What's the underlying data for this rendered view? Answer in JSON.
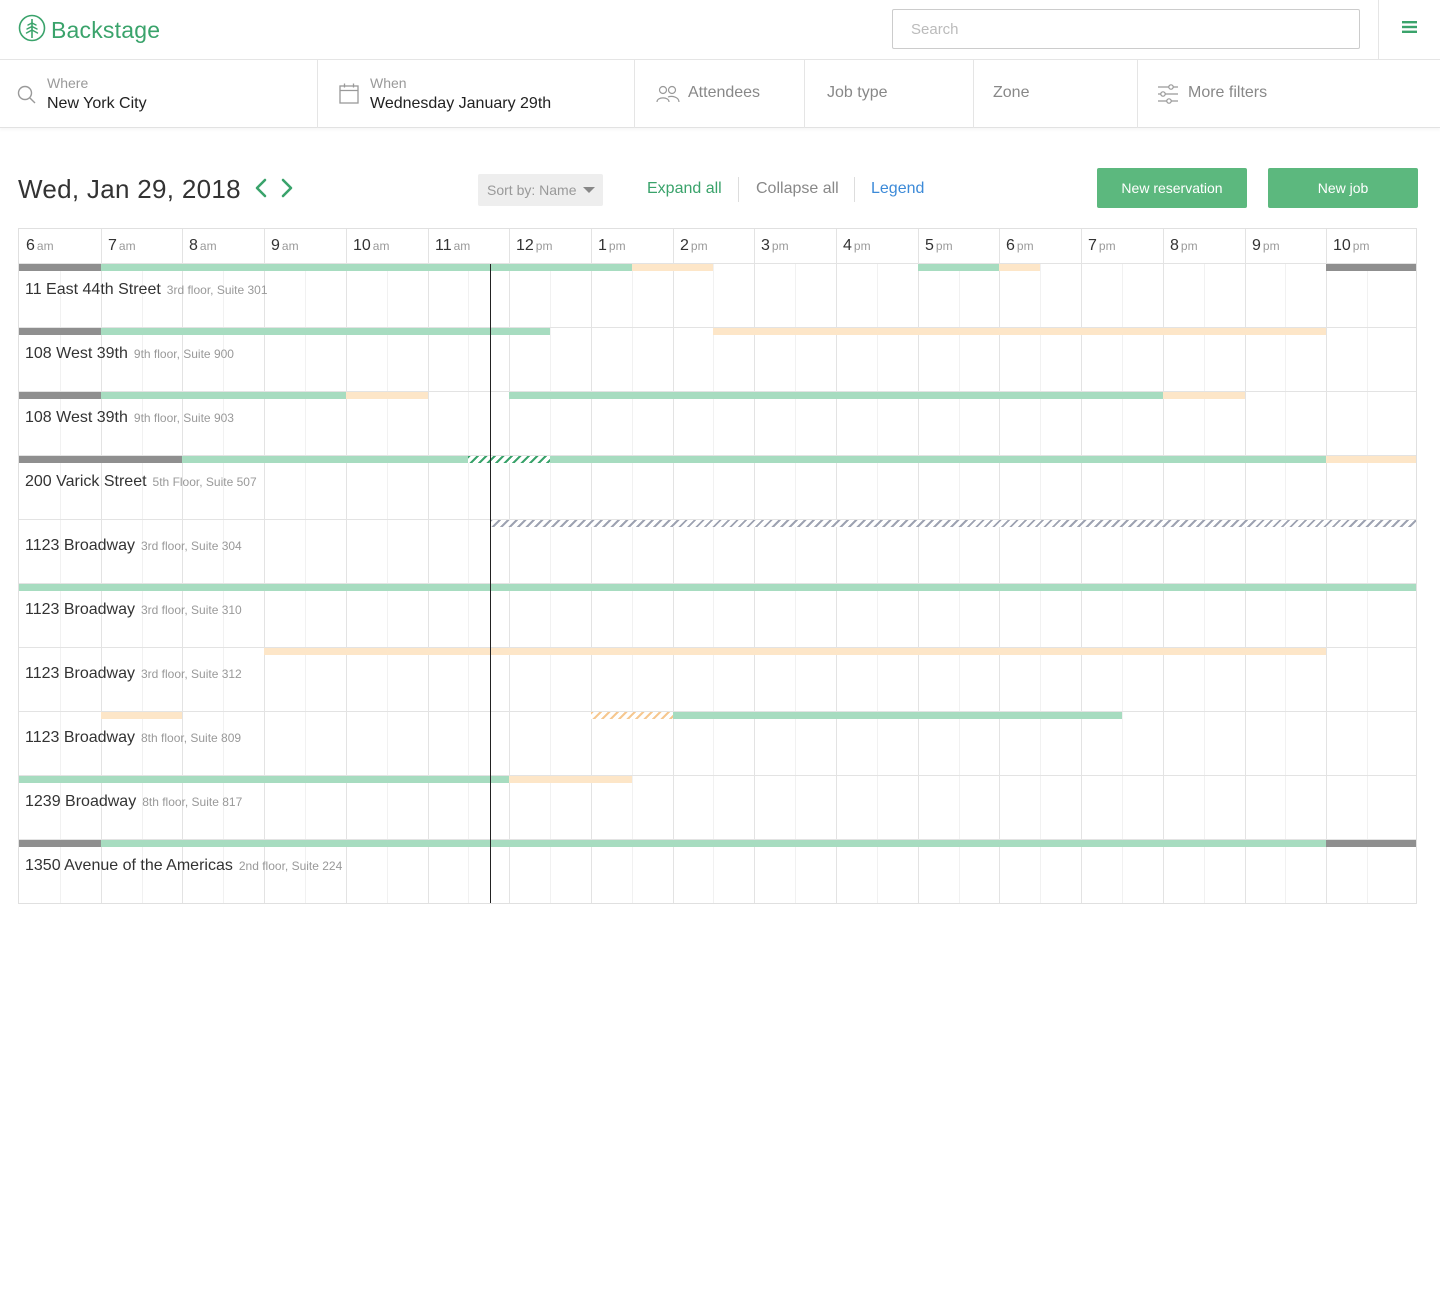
{
  "app": {
    "name": "Backstage"
  },
  "search": {
    "placeholder": "Search"
  },
  "filters": {
    "where": {
      "label": "Where",
      "value": "New York City"
    },
    "when": {
      "label": "When",
      "value": "Wednesday January 29th"
    },
    "attendees": "Attendees",
    "job_type": "Job type",
    "zone": "Zone",
    "more": "More filters"
  },
  "toolbar": {
    "date": "Wed, Jan 29, 2018",
    "sort_label": "Sort by: Name",
    "expand_all": "Expand all",
    "collapse_all": "Collapse all",
    "legend": "Legend",
    "new_reservation": "New reservation",
    "new_job": "New job"
  },
  "colors": {
    "brand": "#3aa36b",
    "button_green": "#5cb87e",
    "link_blue": "#3c8ad8",
    "reserved": "#a7dcc0",
    "pending": "#fde6c8",
    "closed": "#8f8f8f"
  },
  "schedule": {
    "hours": [
      {
        "num": "6",
        "suffix": "am"
      },
      {
        "num": "7",
        "suffix": "am"
      },
      {
        "num": "8",
        "suffix": "am"
      },
      {
        "num": "9",
        "suffix": "am"
      },
      {
        "num": "10",
        "suffix": "am"
      },
      {
        "num": "11",
        "suffix": "am"
      },
      {
        "num": "12",
        "suffix": "pm"
      },
      {
        "num": "1",
        "suffix": "pm"
      },
      {
        "num": "2",
        "suffix": "pm"
      },
      {
        "num": "3",
        "suffix": "pm"
      },
      {
        "num": "4",
        "suffix": "pm"
      },
      {
        "num": "5",
        "suffix": "pm"
      },
      {
        "num": "6",
        "suffix": "pm"
      },
      {
        "num": "7",
        "suffix": "pm"
      },
      {
        "num": "8",
        "suffix": "pm"
      },
      {
        "num": "9",
        "suffix": "pm"
      },
      {
        "num": "10",
        "suffix": "pm"
      }
    ],
    "current_time_hour": 11.77,
    "rows": [
      {
        "name": "11 East 44th Street",
        "detail": "3rd floor, Suite 301",
        "bars": [
          [
            "gray",
            6,
            7
          ],
          [
            "green",
            7,
            13.5
          ],
          [
            "orange",
            13.5,
            14.5
          ],
          [
            "green",
            17,
            18
          ],
          [
            "orange",
            18,
            18.5
          ],
          [
            "gray",
            22,
            23.1
          ]
        ]
      },
      {
        "name": "108 West 39th",
        "detail": "9th floor, Suite 900",
        "bars": [
          [
            "gray",
            6,
            7
          ],
          [
            "green",
            7,
            12.5
          ],
          [
            "orange",
            14.5,
            22
          ]
        ]
      },
      {
        "name": "108 West 39th",
        "detail": "9th floor, Suite 903",
        "bars": [
          [
            "gray",
            6,
            7
          ],
          [
            "green",
            7,
            10
          ],
          [
            "orange",
            10,
            11
          ],
          [
            "green",
            12,
            20
          ],
          [
            "orange",
            20,
            21
          ]
        ]
      },
      {
        "name": "200 Varick Street",
        "detail": "5th Floor, Suite 507",
        "bars": [
          [
            "gray",
            6,
            8
          ],
          [
            "green",
            8,
            11.5
          ],
          [
            "hatch-green",
            11.5,
            12.5
          ],
          [
            "green",
            12.5,
            22
          ],
          [
            "orange",
            22,
            23.1
          ]
        ]
      },
      {
        "name": "1123 Broadway",
        "detail": "3rd floor, Suite 304",
        "bars": [
          [
            "hatch-gray",
            11.77,
            23.1
          ]
        ]
      },
      {
        "name": "1123 Broadway",
        "detail": "3rd floor, Suite 310",
        "bars": [
          [
            "green",
            6,
            23.1
          ]
        ]
      },
      {
        "name": "1123 Broadway",
        "detail": "3rd floor, Suite 312",
        "bars": [
          [
            "orange",
            9,
            22
          ]
        ]
      },
      {
        "name": "1123 Broadway",
        "detail": "8th floor, Suite 809",
        "bars": [
          [
            "orange",
            7,
            8
          ],
          [
            "hatch-orange",
            13,
            14
          ],
          [
            "green",
            14,
            19.5
          ]
        ]
      },
      {
        "name": "1239 Broadway",
        "detail": "8th floor, Suite 817",
        "bars": [
          [
            "green",
            6,
            12
          ],
          [
            "orange",
            12,
            13.5
          ]
        ]
      },
      {
        "name": "1350 Avenue of the Americas",
        "detail": "2nd floor, Suite 224",
        "bars": [
          [
            "gray",
            6,
            7
          ],
          [
            "green",
            7,
            22
          ],
          [
            "gray",
            22,
            23.1
          ]
        ]
      }
    ]
  }
}
